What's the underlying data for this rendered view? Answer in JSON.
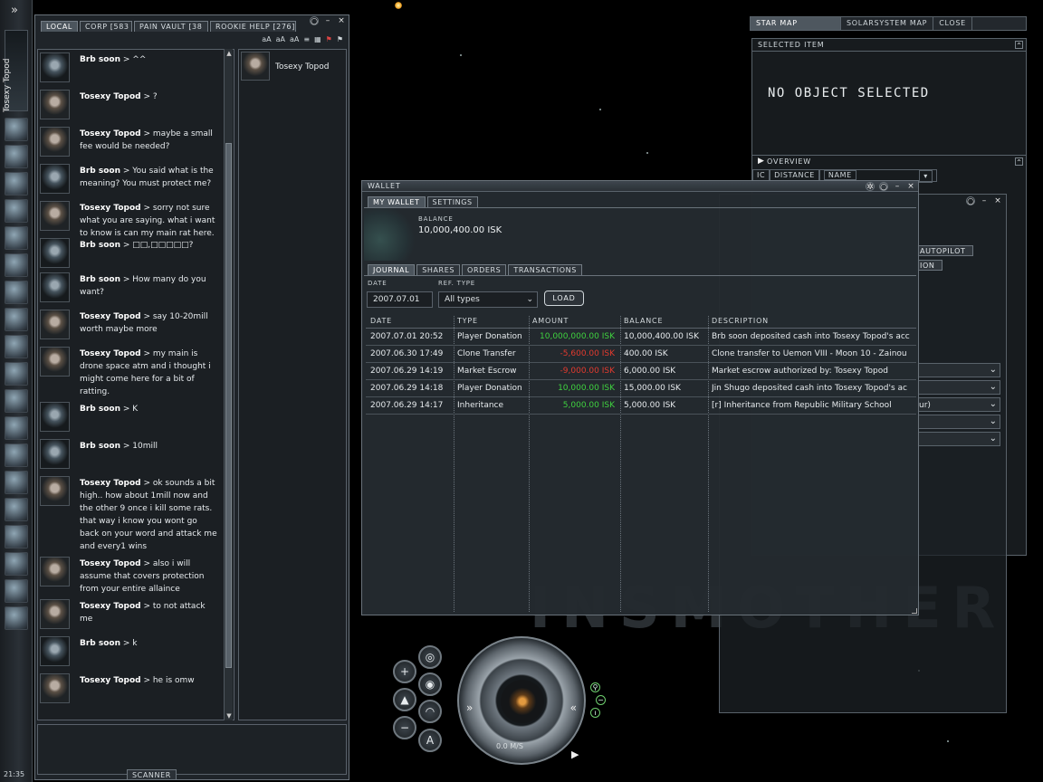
{
  "sidebar": {
    "character_name": "Tosexy Topod",
    "expand_glyph": "»",
    "clock": "21:35",
    "icons": [
      "skills-icon",
      "people-icon",
      "mail-icon",
      "notepad-icon",
      "market-icon",
      "science-icon",
      "contracts-icon",
      "map-icon",
      "corporation-icon",
      "assets-icon",
      "fitting-icon",
      "calculator-icon",
      "help-icon",
      "support-icon",
      "browser-icon",
      "journal-icon",
      "audio-icon",
      "info-icon",
      "character-icon"
    ]
  },
  "chat": {
    "tabs": [
      "LOCAL",
      "CORP [583",
      "PAIN VAULT [38",
      "ROOKIE HELP [276]"
    ],
    "tools": [
      "aA",
      "aA",
      "aA",
      "≡",
      "▦",
      "⚑",
      "⚑"
    ],
    "messages": [
      {
        "sender": "Brb soon",
        "text": "^^"
      },
      {
        "sender": "Tosexy Topod",
        "text": "?"
      },
      {
        "sender": "Tosexy Topod",
        "text": "maybe a small\nfee would be needed?"
      },
      {
        "sender": "Brb soon",
        "text": "You said what is the\nmeaning? You must protect me?"
      },
      {
        "sender": "Tosexy Topod",
        "text": "sorry not sure\nwhat you are saying. what i want\nto know is can my main rat here."
      },
      {
        "sender": "Brb soon",
        "text": "□□,□□□□□?"
      },
      {
        "sender": "Brb soon",
        "text": "How many do you\nwant?"
      },
      {
        "sender": "Tosexy Topod",
        "text": "say 10-20mill\nworth maybe more"
      },
      {
        "sender": "Tosexy Topod",
        "text": "my main is\ndrone space atm and i thought i\nmight come here for a bit of\nratting."
      },
      {
        "sender": "Brb soon",
        "text": "K"
      },
      {
        "sender": "Brb soon",
        "text": "10mill"
      },
      {
        "sender": "Tosexy Topod",
        "text": "ok sounds a bit\nhigh.. how about 1mill now and\nthe other 9 once i kill some rats.\nthat way i know you wont go\nback on your word and attack me\nand every1 wins"
      },
      {
        "sender": "Tosexy Topod",
        "text": "also i will\nassume that covers protection\nfrom your entire allaince"
      },
      {
        "sender": "Tosexy Topod",
        "text": "to not attack\nme"
      },
      {
        "sender": "Brb soon",
        "text": "k"
      },
      {
        "sender": "Tosexy Topod",
        "text": "he is omw"
      }
    ],
    "members": [
      {
        "name": "Tosexy Topod"
      }
    ],
    "scanner_label": "SCANNER"
  },
  "map": {
    "buttons": [
      "STAR MAP",
      "SOLARSYSTEM MAP",
      "CLOSE"
    ]
  },
  "selected_item": {
    "title": "SELECTED ITEM",
    "empty_text": "NO OBJECT SELECTED",
    "overview_title": "OVERVIEW",
    "columns": [
      "IC",
      "DISTANCE",
      "NAME"
    ]
  },
  "background_panel": {
    "autopilot": "AUTOPILOT",
    "animation": "ION",
    "fragment": "ur)"
  },
  "wallet": {
    "title": "WALLET",
    "tabs": [
      "MY WALLET",
      "SETTINGS"
    ],
    "balance_label": "BALANCE",
    "balance_value": "10,000,400.00 ISK",
    "subtabs": [
      "JOURNAL",
      "SHARES",
      "ORDERS",
      "TRANSACTIONS"
    ],
    "date_label": "DATE",
    "date_value": "2007.07.01",
    "reftype_label": "REF. TYPE",
    "reftype_value": "All types",
    "load_label": "LOAD",
    "columns": [
      "DATE",
      "TYPE",
      "AMOUNT",
      "BALANCE",
      "DESCRIPTION"
    ],
    "rows": [
      {
        "date": "2007.07.01  20:52",
        "type": "Player Donation",
        "amount": "10,000,000.00  ISK",
        "sign": "pos",
        "balance": "10,000,400.00  ISK",
        "description": "Brb soon deposited cash into Tosexy Topod's acc"
      },
      {
        "date": "2007.06.30  17:49",
        "type": "Clone Transfer",
        "amount": "-5,600.00  ISK",
        "sign": "neg",
        "balance": "400.00  ISK",
        "description": "Clone transfer to Uemon VIII - Moon 10 - Zainou"
      },
      {
        "date": "2007.06.29  14:19",
        "type": "Market Escrow",
        "amount": "-9,000.00  ISK",
        "sign": "neg",
        "balance": "6,000.00  ISK",
        "description": "Market escrow authorized by: Tosexy Topod"
      },
      {
        "date": "2007.06.29  14:18",
        "type": "Player Donation",
        "amount": "10,000.00  ISK",
        "sign": "pos",
        "balance": "15,000.00  ISK",
        "description": "Jin Shugo deposited cash into Tosexy Topod's ac"
      },
      {
        "date": "2007.06.29  14:17",
        "type": "Inheritance",
        "amount": "5,000.00  ISK",
        "sign": "pos",
        "balance": "5,000.00  ISK",
        "description": "[r] Inheritance from Republic Military School"
      }
    ]
  },
  "hud": {
    "speed": "0.0 M/S",
    "background_text": "INSMOTHER"
  },
  "colors": {
    "positive": "#3fd13f",
    "negative": "#e23a2e",
    "panel": "#282e34"
  }
}
